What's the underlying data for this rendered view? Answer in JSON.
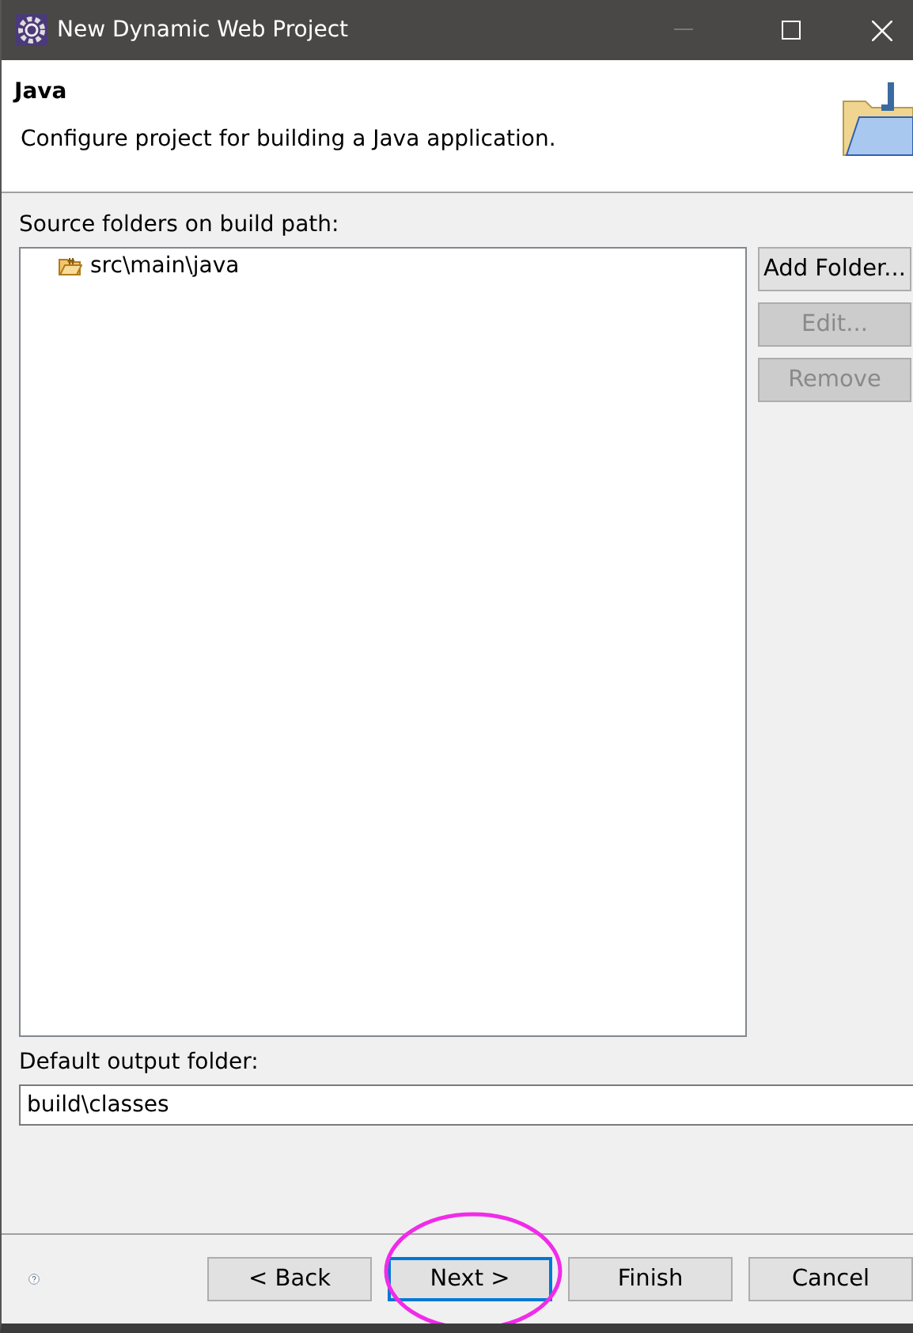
{
  "window": {
    "title": "New Dynamic Web Project"
  },
  "header": {
    "title": "Java",
    "description": "Configure project for building a Java application."
  },
  "source_folders": {
    "label": "Source folders on build path:",
    "items": [
      {
        "label": "src\\main\\java"
      }
    ]
  },
  "side_buttons": [
    {
      "label": "Add Folder...",
      "disabled": false
    },
    {
      "label": "Edit...",
      "disabled": true
    },
    {
      "label": "Remove",
      "disabled": true
    }
  ],
  "output_folder": {
    "label": "Default output folder:",
    "value": "build\\classes"
  },
  "footer_buttons": [
    {
      "label": "< Back",
      "default": false
    },
    {
      "label": "Next >",
      "default": true
    },
    {
      "label": "Finish",
      "default": false
    },
    {
      "label": "Cancel",
      "default": false
    }
  ]
}
